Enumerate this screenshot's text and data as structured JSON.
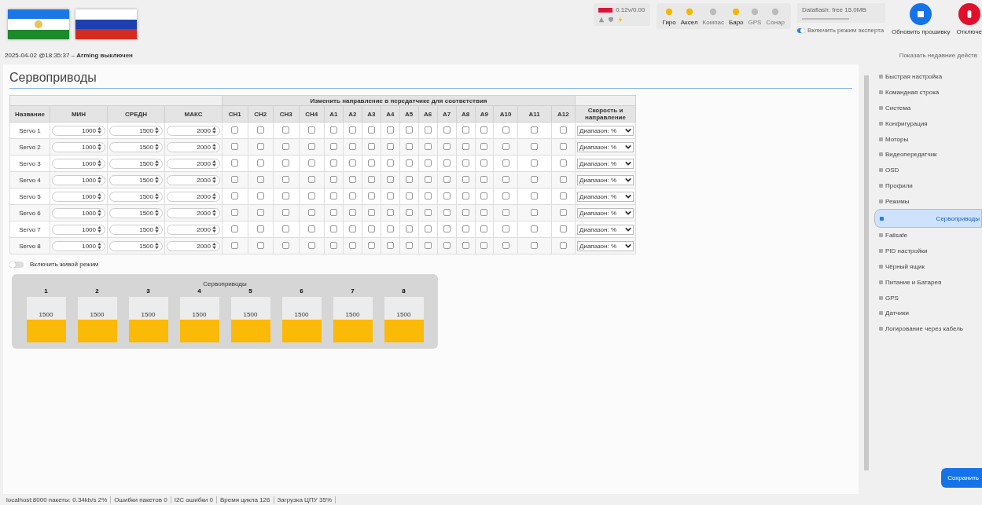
{
  "header": {
    "status_line": "2025-04-02 @18:35:37 – ",
    "arming": "Arming выключен",
    "battery": "0.12v/0.00",
    "sensors": [
      {
        "label": "Гиро",
        "on": true
      },
      {
        "label": "Аксел",
        "on": true
      },
      {
        "label": "Компас",
        "on": false
      },
      {
        "label": "Баро",
        "on": true
      },
      {
        "label": "GPS",
        "on": false
      },
      {
        "label": "Сонар",
        "on": false
      }
    ],
    "dataflash": "Dataflash: free 15.0MB",
    "expert_mode": {
      "label": "Включить режим эксперта",
      "on": true
    },
    "firmware_button": "Обновить прошивку",
    "disconnect_button": "Отключе",
    "recent_actions": "Показать недавние действ"
  },
  "page_title": "Сервоприводы",
  "table": {
    "group_header": "Изменить направление в передатчике для соответствия",
    "columns": [
      "Название",
      "МИН",
      "СРЕДН",
      "МАКС",
      "CH1",
      "CH2",
      "CH3",
      "CH4",
      "A1",
      "A2",
      "A3",
      "A4",
      "A5",
      "A6",
      "A7",
      "A8",
      "A9",
      "A10",
      "A11",
      "A12",
      "Скорость и направление"
    ],
    "rows": [
      {
        "name": "Servo 1",
        "min": "1000",
        "mid": "1500",
        "max": "2000",
        "checks": [
          false,
          false,
          false,
          false,
          false,
          false,
          false,
          false,
          false,
          false,
          false,
          false,
          false,
          false,
          false,
          false
        ],
        "rate": "Диапазон: %"
      },
      {
        "name": "Servo 2",
        "min": "1000",
        "mid": "1500",
        "max": "2000",
        "checks": [
          false,
          false,
          false,
          false,
          false,
          false,
          false,
          false,
          false,
          false,
          false,
          false,
          false,
          false,
          false,
          false
        ],
        "rate": "Диапазон: %"
      },
      {
        "name": "Servo 3",
        "min": "1000",
        "mid": "1500",
        "max": "2000",
        "checks": [
          false,
          false,
          false,
          false,
          false,
          false,
          false,
          false,
          false,
          false,
          false,
          false,
          false,
          false,
          false,
          false
        ],
        "rate": "Диапазон: %"
      },
      {
        "name": "Servo 4",
        "min": "1000",
        "mid": "1500",
        "max": "2000",
        "checks": [
          false,
          false,
          false,
          false,
          false,
          false,
          false,
          false,
          false,
          false,
          false,
          false,
          false,
          false,
          false,
          false
        ],
        "rate": "Диапазон: %"
      },
      {
        "name": "Servo 5",
        "min": "1000",
        "mid": "1500",
        "max": "2000",
        "checks": [
          false,
          false,
          false,
          false,
          false,
          false,
          false,
          false,
          false,
          false,
          false,
          false,
          false,
          false,
          false,
          false
        ],
        "rate": "Диапазон: %"
      },
      {
        "name": "Servo 6",
        "min": "1000",
        "mid": "1500",
        "max": "2000",
        "checks": [
          false,
          false,
          false,
          false,
          false,
          false,
          false,
          false,
          false,
          false,
          false,
          false,
          false,
          false,
          false,
          false
        ],
        "rate": "Диапазон: %"
      },
      {
        "name": "Servo 7",
        "min": "1000",
        "mid": "1500",
        "max": "2000",
        "checks": [
          false,
          false,
          false,
          false,
          false,
          false,
          false,
          false,
          false,
          false,
          false,
          false,
          false,
          false,
          false,
          false
        ],
        "rate": "Диапазон: %"
      },
      {
        "name": "Servo 8",
        "min": "1000",
        "mid": "1500",
        "max": "2000",
        "checks": [
          false,
          false,
          false,
          false,
          false,
          false,
          false,
          false,
          false,
          false,
          false,
          false,
          false,
          false,
          false,
          false
        ],
        "rate": "Диапазон: %"
      }
    ]
  },
  "live_mode": {
    "label": "Включить живой режим",
    "on": false
  },
  "servo_bars": {
    "title": "Сервоприводы",
    "bars": [
      {
        "label": "1",
        "reading": "1500",
        "level": 0.5
      },
      {
        "label": "2",
        "reading": "1500",
        "level": 0.5
      },
      {
        "label": "3",
        "reading": "1500",
        "level": 0.5
      },
      {
        "label": "4",
        "reading": "1500",
        "level": 0.5
      },
      {
        "label": "5",
        "reading": "1500",
        "level": 0.5
      },
      {
        "label": "6",
        "reading": "1500",
        "level": 0.5
      },
      {
        "label": "7",
        "reading": "1500",
        "level": 0.5
      },
      {
        "label": "8",
        "reading": "1500",
        "level": 0.5
      }
    ]
  },
  "sidebar": {
    "items": [
      {
        "label": "Быстрая настройка",
        "selected": false
      },
      {
        "label": "Командная строка",
        "selected": false
      },
      {
        "label": "Система",
        "selected": false
      },
      {
        "label": "Конфигурация",
        "selected": false
      },
      {
        "label": "Моторы",
        "selected": false
      },
      {
        "label": "Видеопередатчик",
        "selected": false
      },
      {
        "label": "OSD",
        "selected": false
      },
      {
        "label": "Профили",
        "selected": false
      },
      {
        "label": "Режимы",
        "selected": false
      },
      {
        "label": "Сервоприводы",
        "selected": true
      },
      {
        "label": "Failsafe",
        "selected": false
      },
      {
        "label": "PID настройки",
        "selected": false
      },
      {
        "label": "Чёрный ящик",
        "selected": false
      },
      {
        "label": "Питание и Батарея",
        "selected": false
      },
      {
        "label": "GPS",
        "selected": false
      },
      {
        "label": "Датчики",
        "selected": false
      },
      {
        "label": "Логирование через кабель",
        "selected": false
      }
    ]
  },
  "save_button": "Сохранить",
  "status_bar": [
    "localhost:8000 пакеты: 0.34kb/s 2%",
    "Ошибки пакетов 0",
    "I2C ошибки 0",
    "Время цикла 126",
    "Загрузка ЦПУ 35%"
  ]
}
